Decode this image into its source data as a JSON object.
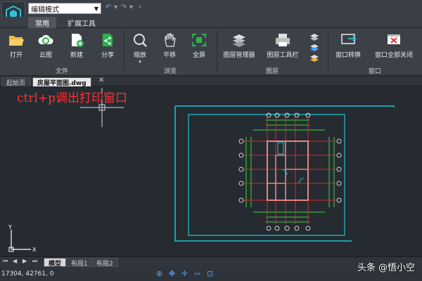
{
  "app": {
    "mode_value": "编辑模式"
  },
  "tabs": [
    {
      "label": "常用"
    },
    {
      "label": "扩展工具"
    }
  ],
  "ribbon": {
    "file": {
      "label": "文件",
      "items": [
        {
          "label": "打开"
        },
        {
          "label": "云图"
        },
        {
          "label": "新建"
        },
        {
          "label": "分享"
        }
      ]
    },
    "view": {
      "label": "浏览",
      "items": [
        {
          "label": "缩放"
        },
        {
          "label": "平移"
        },
        {
          "label": "全屏"
        }
      ]
    },
    "layer": {
      "label": "图层",
      "items": [
        {
          "label": "图层管理器"
        },
        {
          "label": "图层工具栏"
        }
      ]
    },
    "window": {
      "label": "窗口",
      "items": [
        {
          "label": "窗口转换"
        },
        {
          "label": "窗口全部关闭"
        }
      ]
    }
  },
  "doc_tabs": [
    {
      "label": "起始页"
    },
    {
      "label": "房屋平面图.dwg"
    }
  ],
  "canvas": {
    "annotation": "ctrl+p调出打印窗口"
  },
  "layout_tabs": [
    {
      "label": "模型"
    },
    {
      "label": "布局1"
    },
    {
      "label": "布局2"
    }
  ],
  "status": {
    "coords": "17304, 42761, 0"
  },
  "watermark": "头条 @悟小空",
  "colors": {
    "ribbon_bg": "#3c4148",
    "canvas_bg": "#262b31",
    "annotation": "#ff3333",
    "frame": "#19c6cf"
  }
}
